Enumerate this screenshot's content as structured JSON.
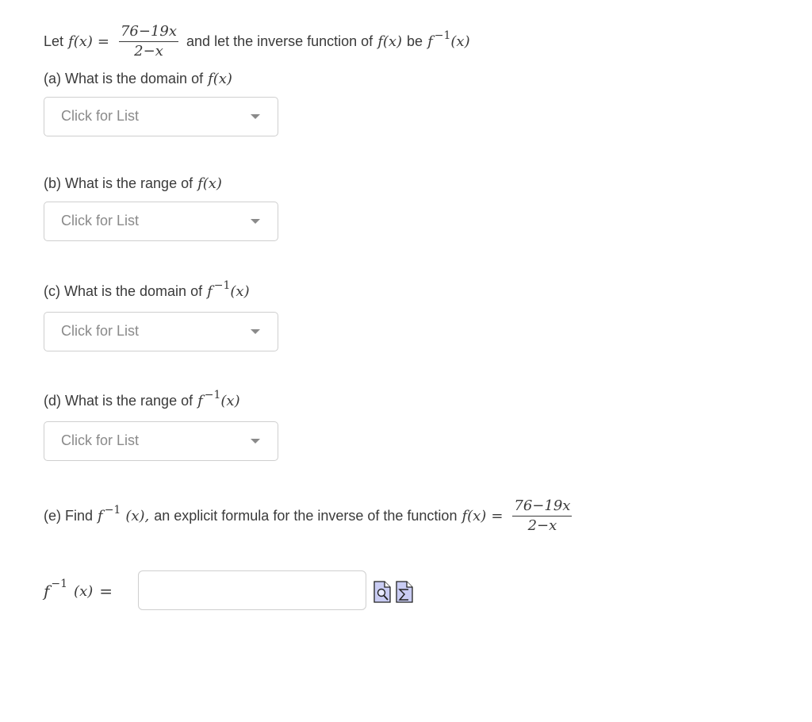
{
  "intro": {
    "let": "Let",
    "f_of_x": "f(x)",
    "equals": "=",
    "numerator": "76−19x",
    "denominator": "2−x",
    "middle_text": "and let  the inverse function of",
    "f_of_x_2": "f(x)",
    "be": "be",
    "finv_f": "f",
    "finv_sup": "−1",
    "finv_arg": "(x)"
  },
  "questions": [
    {
      "label": "(a) What is the domain of",
      "math": "f(x)",
      "inverse": false,
      "select_placeholder": "Click for List"
    },
    {
      "label": "(b) What is the range of",
      "math": "f(x)",
      "inverse": false,
      "select_placeholder": "Click for List"
    },
    {
      "label": "(c) What is the domain of",
      "math_f": "f",
      "math_sup": "−1",
      "math_arg": "(x)",
      "inverse": true,
      "select_placeholder": "Click for List"
    },
    {
      "label": "(d) What is the range of",
      "math_f": "f",
      "math_sup": "−1",
      "math_arg": "(x)",
      "inverse": true,
      "select_placeholder": "Click for List"
    }
  ],
  "part_e": {
    "prefix": "(e) Find",
    "finv_f": "f",
    "finv_sup": "−1",
    "finv_arg": "(x),",
    "middle_text": "an explicit formula for the inverse of the function",
    "f_of_x": "f(x)",
    "equals": "=",
    "numerator": "76−19x",
    "denominator": "2−x"
  },
  "answer": {
    "lhs_f": "f",
    "lhs_sup": "−1",
    "lhs_arg": "(x)",
    "equals": "=",
    "value": "",
    "preview_icon": "preview-magnifier-icon",
    "equation_editor_icon": "sigma-equation-icon"
  }
}
